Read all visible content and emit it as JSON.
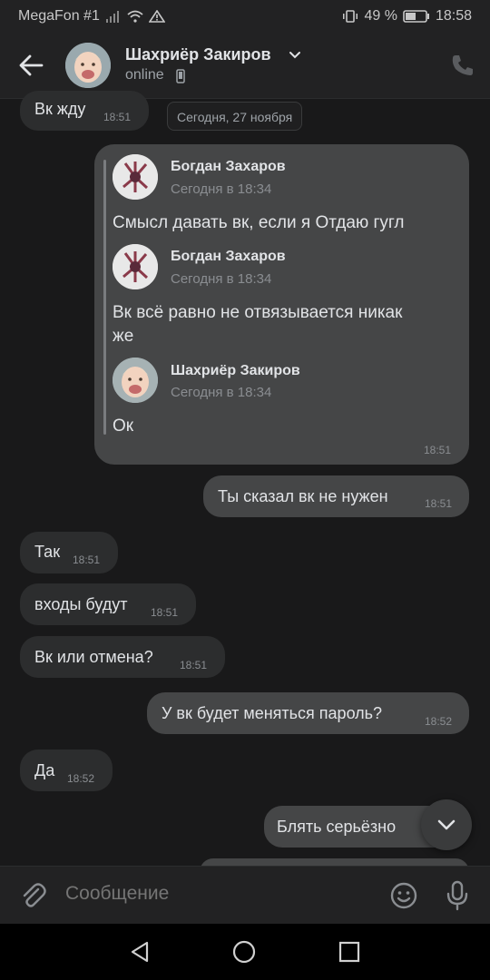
{
  "status_bar": {
    "carrier": "MegaFon #1",
    "battery_percent": "49 %",
    "time": "18:58"
  },
  "header": {
    "contact_name": "Шахриёр Закиров",
    "contact_status": "online",
    "icons": [
      "back-arrow-icon",
      "chevron-down-icon",
      "mobile-phone-icon",
      "phone-call-icon"
    ]
  },
  "messages": {
    "m1": {
      "text": "Вк жду",
      "time": "18:51"
    },
    "date_chip": "Сегодня, 27 ноября",
    "forward": {
      "time": "18:51",
      "items": [
        {
          "author": "Богдан Захаров",
          "date": "Сегодня в 18:34",
          "text": "Смысл давать вк, если я Отдаю гугл"
        },
        {
          "author": "Богдан Захаров",
          "date": "Сегодня в 18:34",
          "text_line1": "Вк всё равно не отвязывается никак",
          "text_line2": "же"
        },
        {
          "author": "Шахриёр Закиров",
          "date": "Сегодня в 18:34",
          "text": "Ок"
        }
      ]
    },
    "m2": {
      "text": "Ты сказал вк не нужен",
      "time": "18:51"
    },
    "m3": {
      "text": "Так",
      "time": "18:51"
    },
    "m4": {
      "text": "входы будут",
      "time": "18:51"
    },
    "m5": {
      "text": "Вк или отмена?",
      "time": "18:51"
    },
    "m6": {
      "text": "У вк будет меняться пароль?",
      "time": "18:52"
    },
    "m7": {
      "text": "Да",
      "time": "18:52"
    },
    "m8": {
      "text": "Блять серьёзно"
    }
  },
  "composer": {
    "placeholder": "Сообщение",
    "icons": [
      "paperclip-icon",
      "emoji-icon",
      "microphone-icon"
    ]
  },
  "colors": {
    "background": "#19191a",
    "incoming_bubble": "#2c2d2e",
    "outgoing_bubble": "#454647",
    "text": "#e1e3e6",
    "muted": "#8a8d91"
  }
}
